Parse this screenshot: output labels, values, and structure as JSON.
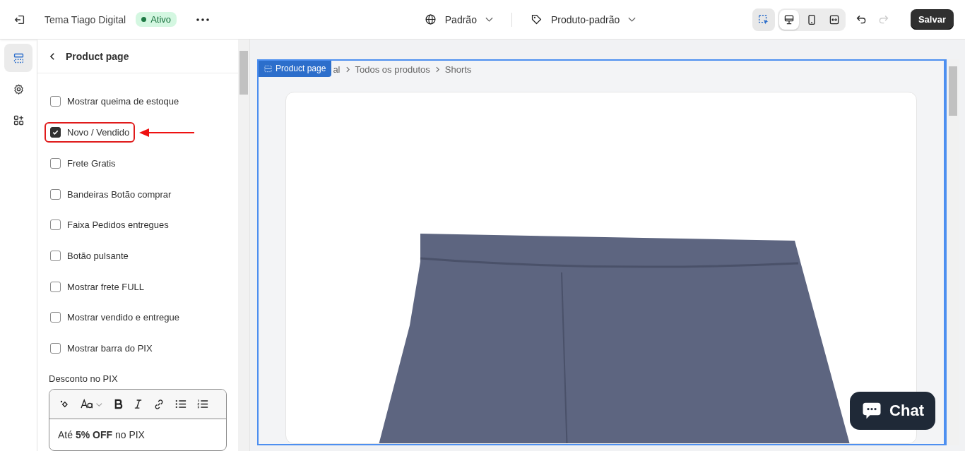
{
  "topbar": {
    "theme_name": "Tema Tiago Digital",
    "status_badge": "Ativo",
    "language": "Padrão",
    "template": "Produto-padrão",
    "save_button": "Salvar"
  },
  "device_buttons": [
    {
      "kind": "desktop",
      "selected": true
    },
    {
      "kind": "mobile",
      "selected": false
    },
    {
      "kind": "fullwidth",
      "selected": false
    }
  ],
  "rail": [
    {
      "kind": "sections",
      "selected": true
    },
    {
      "kind": "settings",
      "selected": false
    },
    {
      "kind": "apps",
      "selected": false
    }
  ],
  "panel": {
    "title": "Product page",
    "checkboxes": [
      {
        "label": "Mostrar queima de estoque",
        "checked": false,
        "highlighted": false
      },
      {
        "label": "Novo / Vendido",
        "checked": true,
        "highlighted": true
      },
      {
        "label": "Frete Gratis",
        "checked": false,
        "highlighted": false
      },
      {
        "label": "Bandeiras Botão comprar",
        "checked": false,
        "highlighted": false
      },
      {
        "label": "Faixa Pedidos entregues",
        "checked": false,
        "highlighted": false
      },
      {
        "label": "Botão pulsante",
        "checked": false,
        "highlighted": false
      },
      {
        "label": "Mostrar frete FULL",
        "checked": false,
        "highlighted": false
      },
      {
        "label": "Mostrar vendido e entregue",
        "checked": false,
        "highlighted": false
      },
      {
        "label": "Mostrar barra do PIX",
        "checked": false,
        "highlighted": false
      }
    ],
    "editor": {
      "label": "Desconto no PIX",
      "value": "Até **5% OFF** no PIX"
    }
  },
  "preview": {
    "section_tag": "Product page",
    "breadcrumb": [
      "al",
      "Todos os produtos",
      "Shorts"
    ],
    "chat_button": "Chat"
  }
}
